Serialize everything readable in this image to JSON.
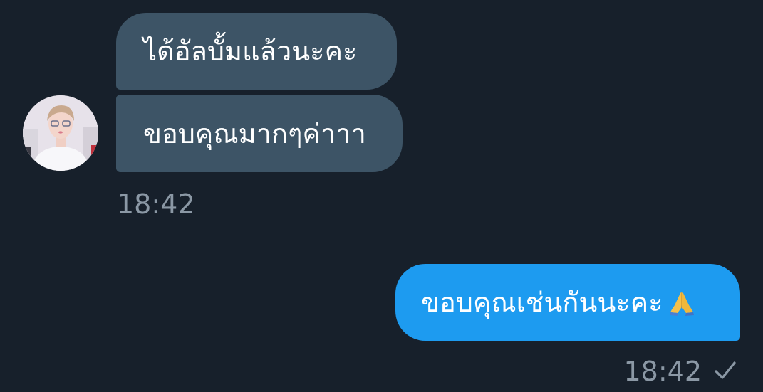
{
  "conversation": {
    "incoming": {
      "avatar_icon": "user-avatar-photo",
      "messages": [
        {
          "text": "ได้อัลบั้มแล้วนะคะ"
        },
        {
          "text": "ขอบคุณมากๆค่าาา"
        }
      ],
      "timestamp": "18:42"
    },
    "outgoing": {
      "messages": [
        {
          "text": "ขอบคุณเช่นกันนะคะ",
          "emoji": "folded-hands-emoji"
        }
      ],
      "timestamp": "18:42",
      "status_icon": "checkmark-icon"
    }
  },
  "colors": {
    "background": "#17202b",
    "incoming_bubble": "#3d5466",
    "outgoing_bubble": "#1d9bf0",
    "timestamp": "#8b98a5",
    "text": "#ffffff"
  }
}
